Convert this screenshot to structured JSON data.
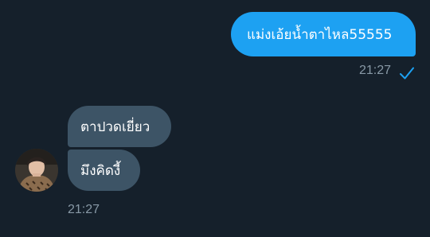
{
  "conversation": {
    "messages": [
      {
        "direction": "outgoing",
        "text": "แม่งเอ้ยน้ำตาไหล55555"
      },
      {
        "direction": "incoming",
        "text": "ตาปวดเยี่ยว"
      },
      {
        "direction": "incoming",
        "text": "มึงคิดงี้"
      }
    ],
    "outgoing_time": "21:27",
    "incoming_time": "21:27",
    "read_receipt_icon": "check-icon",
    "accent_color": "#1da1f2",
    "incoming_bubble_color": "#3d5466",
    "background_color": "#15202b",
    "timestamp_color": "#8899a6"
  }
}
